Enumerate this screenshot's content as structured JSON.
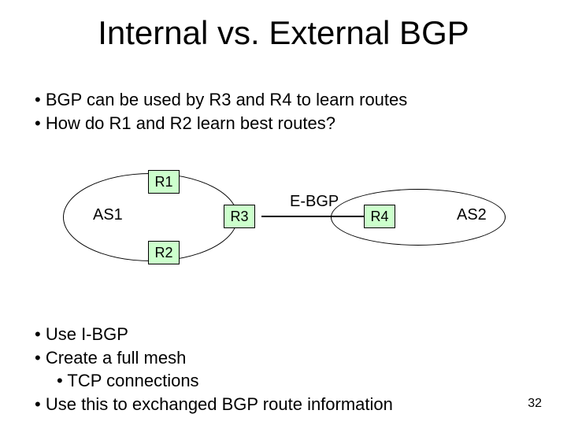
{
  "title": "Internal vs. External BGP",
  "top_bullets": {
    "b1": "BGP can be used by R3 and R4 to learn routes",
    "b2": "How do R1 and R2 learn best routes?"
  },
  "diagram": {
    "as1_label": "AS1",
    "as2_label": "AS2",
    "r1": "R1",
    "r2": "R2",
    "r3": "R3",
    "r4": "R4",
    "ebgp_label": "E-BGP"
  },
  "bottom_bullets": {
    "b1": "Use I-BGP",
    "b2": "Create a full mesh",
    "b2_sub": "TCP connections",
    "b3": "Use this to exchanged BGP route information"
  },
  "page_number": "32"
}
